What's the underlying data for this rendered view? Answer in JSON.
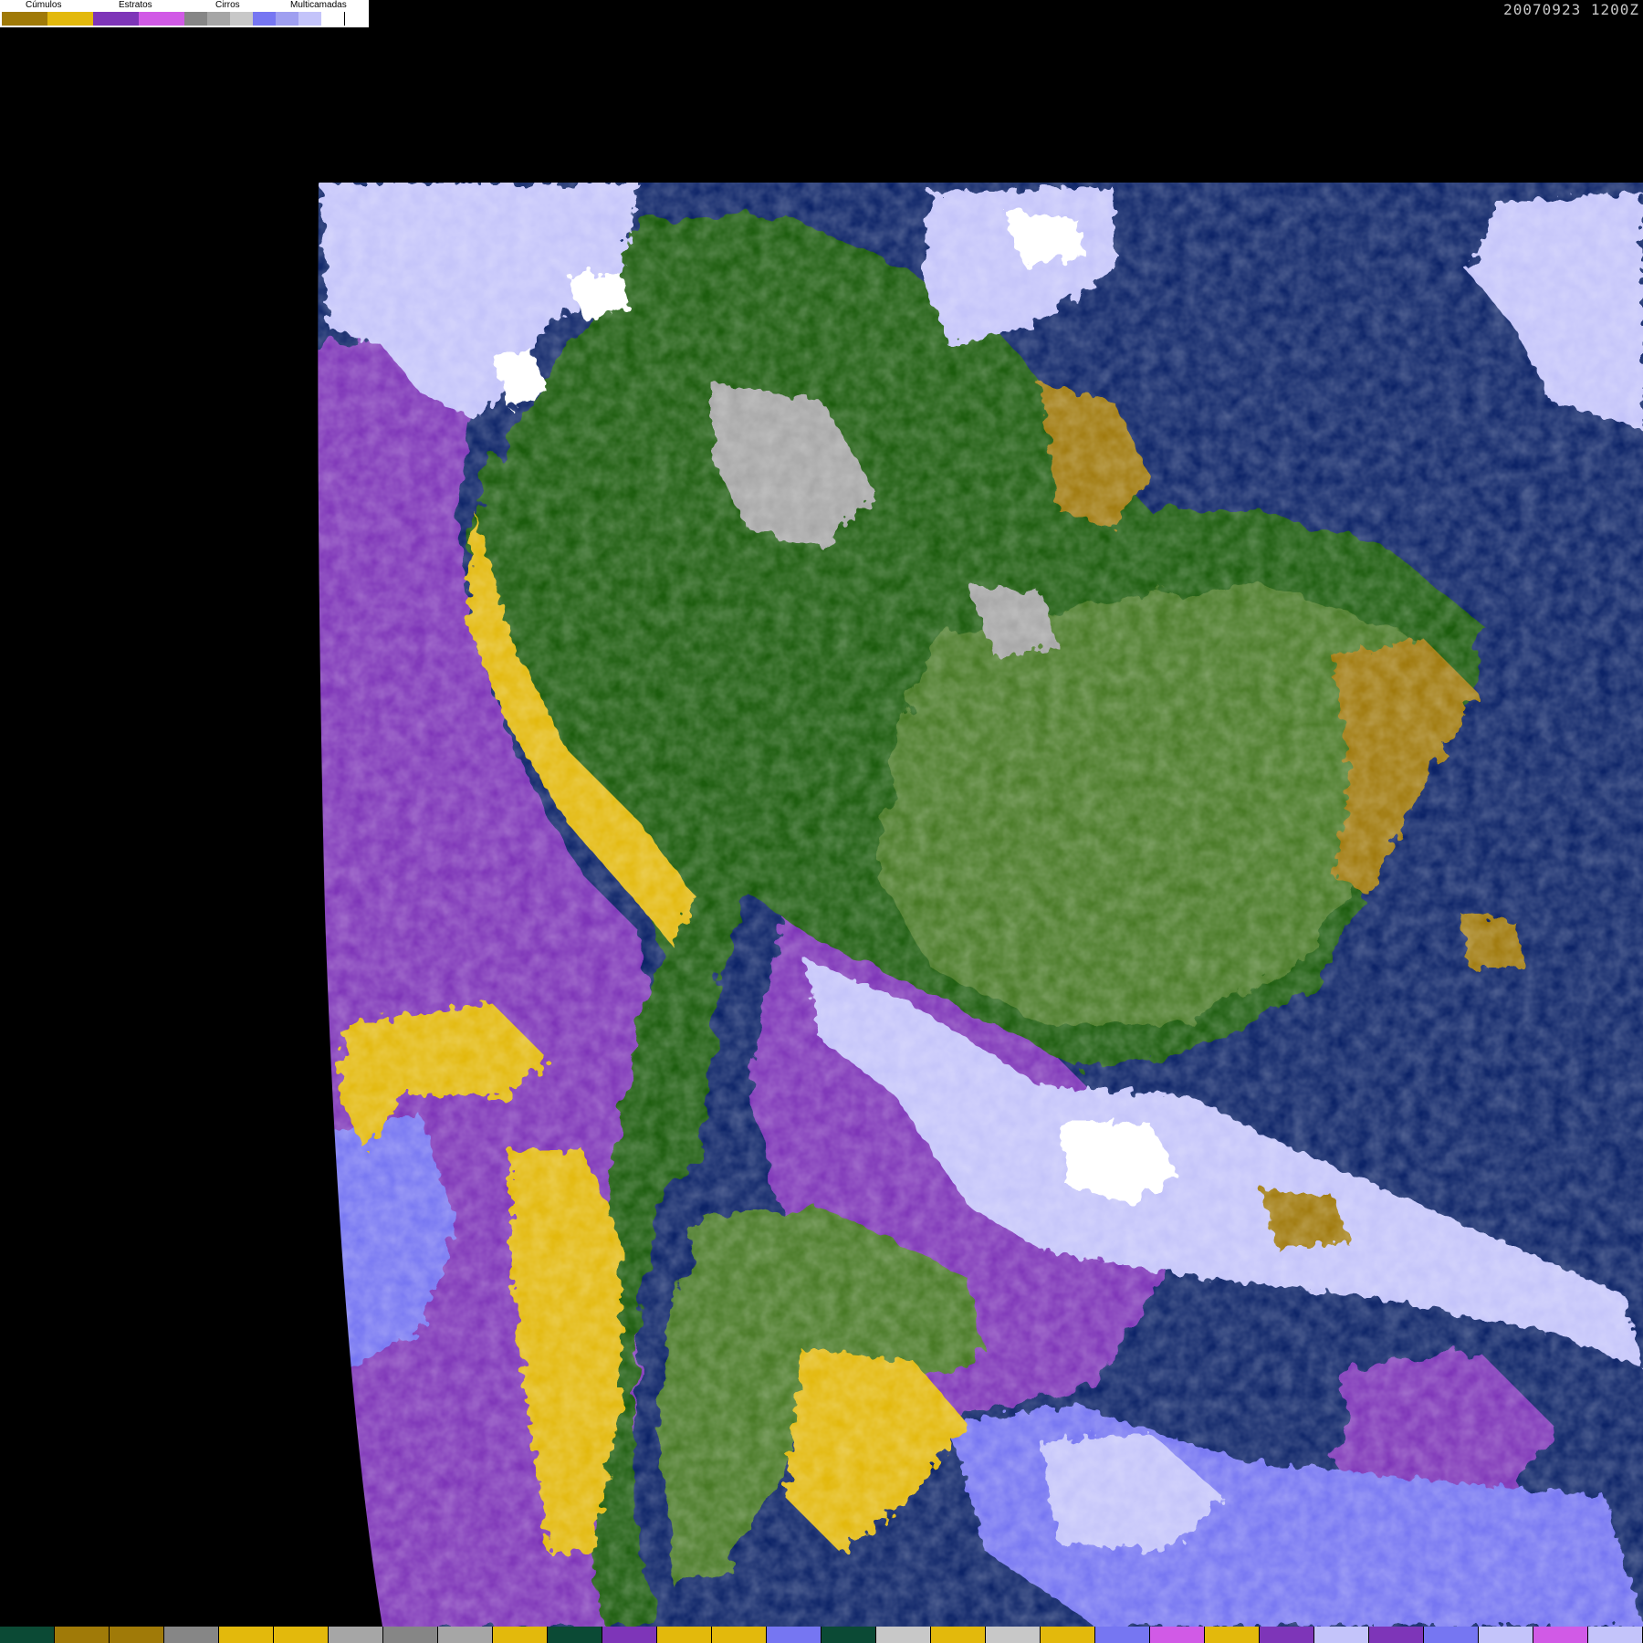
{
  "timestamp": "20070923 1200Z",
  "legend": {
    "groups": [
      {
        "label": "Cúmulos",
        "colors": [
          "#a07a08",
          "#e3b90c"
        ]
      },
      {
        "label": "Estratos",
        "colors": [
          "#7e35b8",
          "#d15ae6"
        ]
      },
      {
        "label": "Cirros",
        "colors": [
          "#868686",
          "#a6a6a6",
          "#c8c8c8"
        ]
      },
      {
        "label": "Multicamadas",
        "colors": [
          "#7676f2",
          "#9f9ff0",
          "#c4c4fa",
          "#ffffff"
        ]
      }
    ]
  },
  "colors": {
    "background": "#000000",
    "ocean": "#0c2367",
    "land_forest": "#1f5c0b",
    "land_savanna": "#4a7a25",
    "stratus": "#7e35b8",
    "stratus_light": "#d15ae6",
    "cumulus": "#e3b90c",
    "cumulus_dark": "#a07a08",
    "cirrus": "#a6a6a6",
    "multilayer": "#c4c4fa",
    "multilayer_mid": "#7676f2",
    "multilayer_top": "#ffffff"
  },
  "bottom_bar": [
    "#0b4a35",
    "#a07a08",
    "#a07a08",
    "#868686",
    "#e3b90c",
    "#e3b90c",
    "#a6a6a6",
    "#868686",
    "#a6a6a6",
    "#e3b90c",
    "#0b4a35",
    "#7e35b8",
    "#e3b90c",
    "#e3b90c",
    "#7676f2",
    "#0b4a35",
    "#c8c8c8",
    "#e3b90c",
    "#c8c8c8",
    "#e3b90c",
    "#7676f2",
    "#d15ae6",
    "#e3b90c",
    "#7e35b8",
    "#c4c4fa",
    "#7e35b8",
    "#7676f2",
    "#c4c4fa",
    "#d15ae6",
    "#c4c4fa"
  ]
}
